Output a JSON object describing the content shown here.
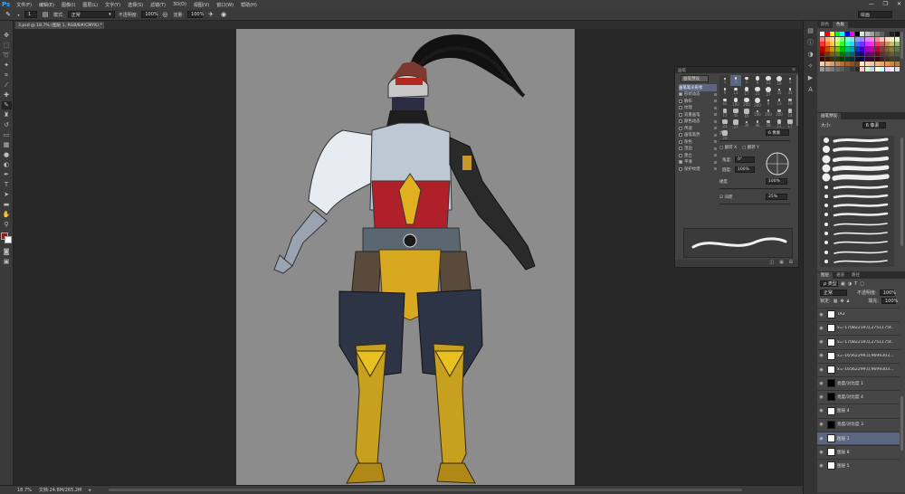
{
  "app": {
    "logo": "Ps",
    "menus": [
      "文件(F)",
      "编辑(E)",
      "图像(I)",
      "图层(L)",
      "文字(Y)",
      "选择(S)",
      "滤镜(T)",
      "3D(D)",
      "视图(V)",
      "窗口(W)",
      "帮助(H)"
    ],
    "window_controls": [
      "—",
      "❐",
      "✕"
    ]
  },
  "options": {
    "brush_size": "1",
    "mode_label": "模式:",
    "mode_value": "正常",
    "opacity_label": "不透明度:",
    "opacity_value": "100%",
    "flow_label": "流量:",
    "flow_value": "100%",
    "workspace": "绘画"
  },
  "document": {
    "tab_title": "3.psd @ 18.7% (图层 1, RGB/8#/CMYK) *",
    "close": "×"
  },
  "status": {
    "zoom": "18.7%",
    "doc_info": "文档:24.8M/265.2M"
  },
  "swatches_panel": {
    "tabs": [
      "颜色",
      "色板"
    ],
    "colors": [
      "#ffffff",
      "#ff0000",
      "#ffff00",
      "#00ff00",
      "#00ffff",
      "#0000ff",
      "#ff00ff",
      "#000000",
      "#e0e0e0",
      "#c0c0c0",
      "#a0a0a0",
      "#808080",
      "#606060",
      "#404040",
      "#202020",
      "#101010",
      "#ff8080",
      "#ffb080",
      "#ffe080",
      "#e0ff80",
      "#80ff80",
      "#80ffd0",
      "#80e0ff",
      "#80a0ff",
      "#a080ff",
      "#e080ff",
      "#ff80e0",
      "#ff80a0",
      "#ffc0c0",
      "#ffe0c0",
      "#fff0c0",
      "#e0ffc0",
      "#ff3030",
      "#ff8030",
      "#ffd030",
      "#c0ff30",
      "#30ff30",
      "#30ffb0",
      "#30d0ff",
      "#3070ff",
      "#7030ff",
      "#d030ff",
      "#ff30d0",
      "#ff3070",
      "#c06060",
      "#c09060",
      "#c0c060",
      "#90c060",
      "#c00000",
      "#c05000",
      "#c0a000",
      "#80c000",
      "#00c000",
      "#00c080",
      "#00a0c0",
      "#0040c0",
      "#4000c0",
      "#a000c0",
      "#c000a0",
      "#c00040",
      "#804040",
      "#806040",
      "#808040",
      "#608040",
      "#800000",
      "#803000",
      "#806000",
      "#508000",
      "#008000",
      "#008050",
      "#006080",
      "#002080",
      "#200080",
      "#600080",
      "#800060",
      "#800020",
      "#603030",
      "#604830",
      "#606030",
      "#486030",
      "#400000",
      "#401800",
      "#403000",
      "#284000",
      "#004000",
      "#004028",
      "#003040",
      "#001040",
      "#100040",
      "#300040",
      "#400030",
      "#400010",
      "#402020",
      "#403020",
      "#404020",
      "#304020",
      "#f0d0b0",
      "#e0b890",
      "#d0a070",
      "#c08850",
      "#b07040",
      "#a06030",
      "#905020",
      "#804010",
      "#ffe8d0",
      "#f8d8b8",
      "#f0c8a0",
      "#e8b888",
      "#e0a870",
      "#d89858",
      "#d08840",
      "#c87830",
      "#9a9a9a",
      "#8a8a8a",
      "#7a7a7a",
      "#6a6a6a",
      "#5a5a5a",
      "#4a4a4a",
      "#3a3a3a",
      "#2a2a2a",
      "#ffcccc",
      "#ccffcc",
      "#ccccff",
      "#ffffcc",
      "#ccffff",
      "#ffccff",
      "#eeeeee",
      "#dddddd"
    ]
  },
  "brush_panel": {
    "tabs": [
      "画笔预设"
    ],
    "size_label": "大小:",
    "size_value": "6 像素",
    "close": "×"
  },
  "layers_panel": {
    "tabs": [
      "图层",
      "通道",
      "路径"
    ],
    "filter": "ρ 类型",
    "blend_mode": "正常",
    "opacity_label": "不透明度:",
    "opacity_value": "100%",
    "lock_label": "锁定:",
    "fill_label": "填充:",
    "fill_value": "100%",
    "layers": [
      {
        "name": "TA3",
        "thumb": "white"
      },
      {
        "name": "x=-17082219,0,2751175t...",
        "thumb": "white"
      },
      {
        "name": "x=-17082219,0,2751175t...",
        "thumb": "white"
      },
      {
        "name": "x=-16562299,0,9699303...",
        "thumb": "white"
      },
      {
        "name": "x=-16562299,0,9699303...",
        "thumb": "white"
      },
      {
        "name": "亮度/对比度 1",
        "thumb": "mask"
      },
      {
        "name": "亮度/对比度 4",
        "thumb": "mask"
      },
      {
        "name": "图层 4",
        "thumb": "white"
      },
      {
        "name": "亮度/对比度 3",
        "thumb": "mask"
      },
      {
        "name": "图层 1",
        "thumb": "white",
        "selected": true
      },
      {
        "name": "图层 8",
        "thumb": "white"
      },
      {
        "name": "图层 5",
        "thumb": "white"
      }
    ]
  },
  "brush_float": {
    "title": "画笔",
    "preset_button": "画笔预设",
    "options": [
      {
        "label": "画笔笔尖形状",
        "checkbox": false,
        "selected": true
      },
      {
        "label": "形状动态",
        "checkbox": true,
        "on": true
      },
      {
        "label": "散布",
        "checkbox": true,
        "on": false
      },
      {
        "label": "纹理",
        "checkbox": true,
        "on": false
      },
      {
        "label": "双重画笔",
        "checkbox": true,
        "on": false
      },
      {
        "label": "颜色动态",
        "checkbox": true,
        "on": false
      },
      {
        "label": "传递",
        "checkbox": true,
        "on": false
      },
      {
        "label": "画笔笔势",
        "checkbox": true,
        "on": false
      },
      {
        "label": "杂色",
        "checkbox": true,
        "on": false
      },
      {
        "label": "湿边",
        "checkbox": true,
        "on": false
      },
      {
        "label": "建立",
        "checkbox": true,
        "on": false
      },
      {
        "label": "平滑",
        "checkbox": true,
        "on": true
      },
      {
        "label": "保护纹理",
        "checkbox": true,
        "on": false
      }
    ],
    "tip_sizes": [
      "1",
      "3",
      "5",
      "9",
      "13",
      "19",
      "5",
      "9",
      "13",
      "17",
      "21",
      "27",
      "35",
      "45",
      "65",
      "100",
      "200",
      "300",
      "9",
      "13",
      "19",
      "17",
      "45",
      "65",
      "100",
      "200",
      "300",
      "14",
      "24",
      "27",
      "39",
      "46",
      "59",
      "11",
      "17",
      "23"
    ],
    "size_label": "大小",
    "size_value": "6 像素",
    "flip_x": "翻转 X",
    "flip_y": "翻转 Y",
    "angle_label": "角度:",
    "angle_value": "0°",
    "roundness_label": "圆度:",
    "roundness_value": "100%",
    "hardness_label": "硬度",
    "hardness_value": "100%",
    "spacing_label": "间距",
    "spacing_value": "25%"
  }
}
